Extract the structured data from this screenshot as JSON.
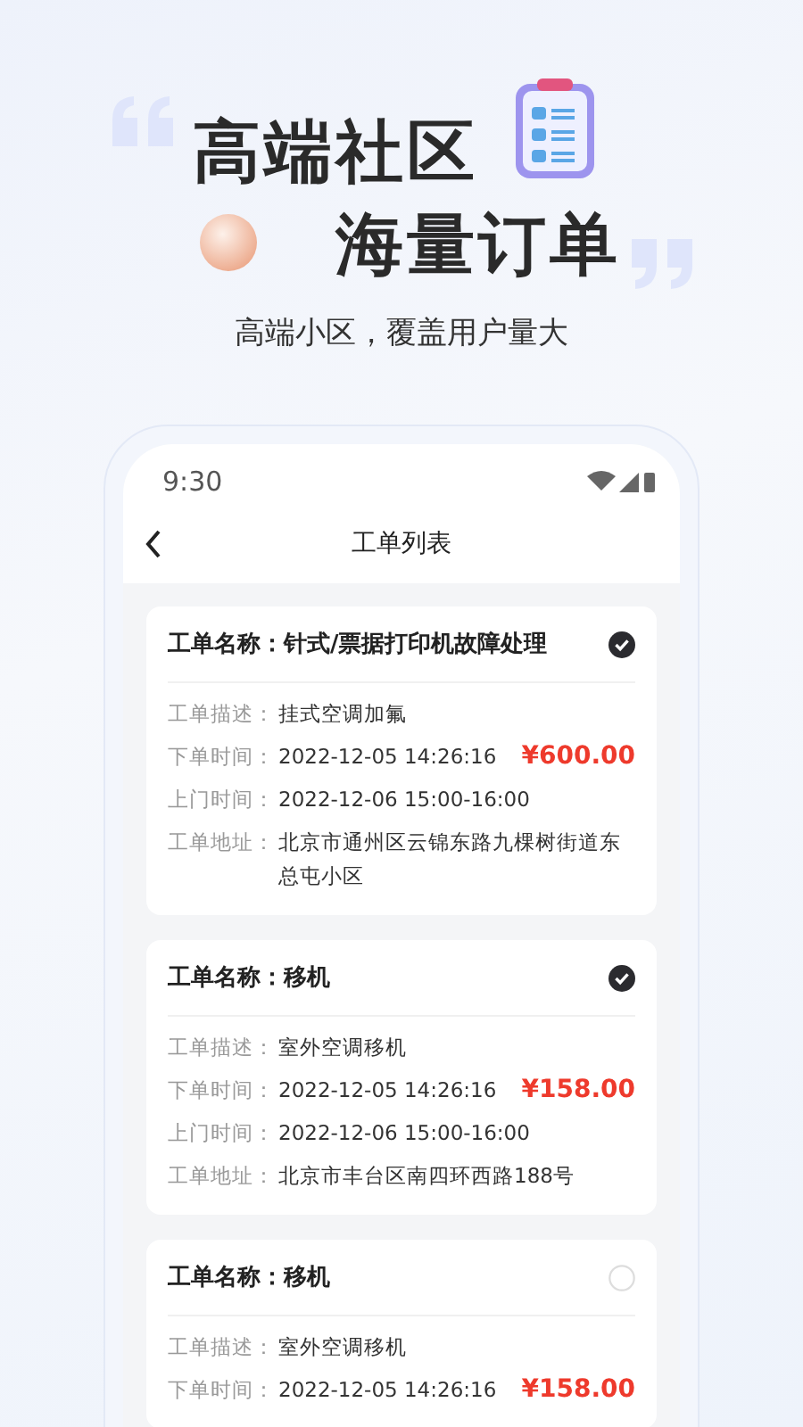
{
  "headline": {
    "line_1": "高端社区",
    "line_2": "海量订单",
    "subtitle": "高端小区，覆盖用户量大"
  },
  "phone": {
    "status_bar": {
      "time": "9:30"
    },
    "nav": {
      "title": "工单列表"
    },
    "orders": [
      {
        "name_label": "工单名称：",
        "name": "针式/票据打印机故障处理",
        "selected": true,
        "fields": [
          {
            "label": "工单描述：",
            "value": "挂式空调加氟"
          },
          {
            "label": "下单时间：",
            "value": "2022-12-05 14:26:16",
            "price": "¥600.00"
          },
          {
            "label": "上门时间：",
            "value": "2022-12-06 15:00-16:00"
          },
          {
            "label": "工单地址：",
            "value": "北京市通州区云锦东路九棵树街道东总屯小区"
          }
        ]
      },
      {
        "name_label": "工单名称：",
        "name": "移机",
        "selected": true,
        "fields": [
          {
            "label": "工单描述：",
            "value": "室外空调移机"
          },
          {
            "label": "下单时间：",
            "value": "2022-12-05 14:26:16",
            "price": "¥158.00"
          },
          {
            "label": "上门时间：",
            "value": "2022-12-06 15:00-16:00"
          },
          {
            "label": "工单地址：",
            "value": "北京市丰台区南四环西路188号"
          }
        ]
      },
      {
        "name_label": "工单名称：",
        "name": "移机",
        "selected": false,
        "fields": [
          {
            "label": "工单描述：",
            "value": "室外空调移机"
          },
          {
            "label": "下单时间：",
            "value": "2022-12-05 14:26:16",
            "price": "¥158.00"
          }
        ]
      }
    ]
  }
}
